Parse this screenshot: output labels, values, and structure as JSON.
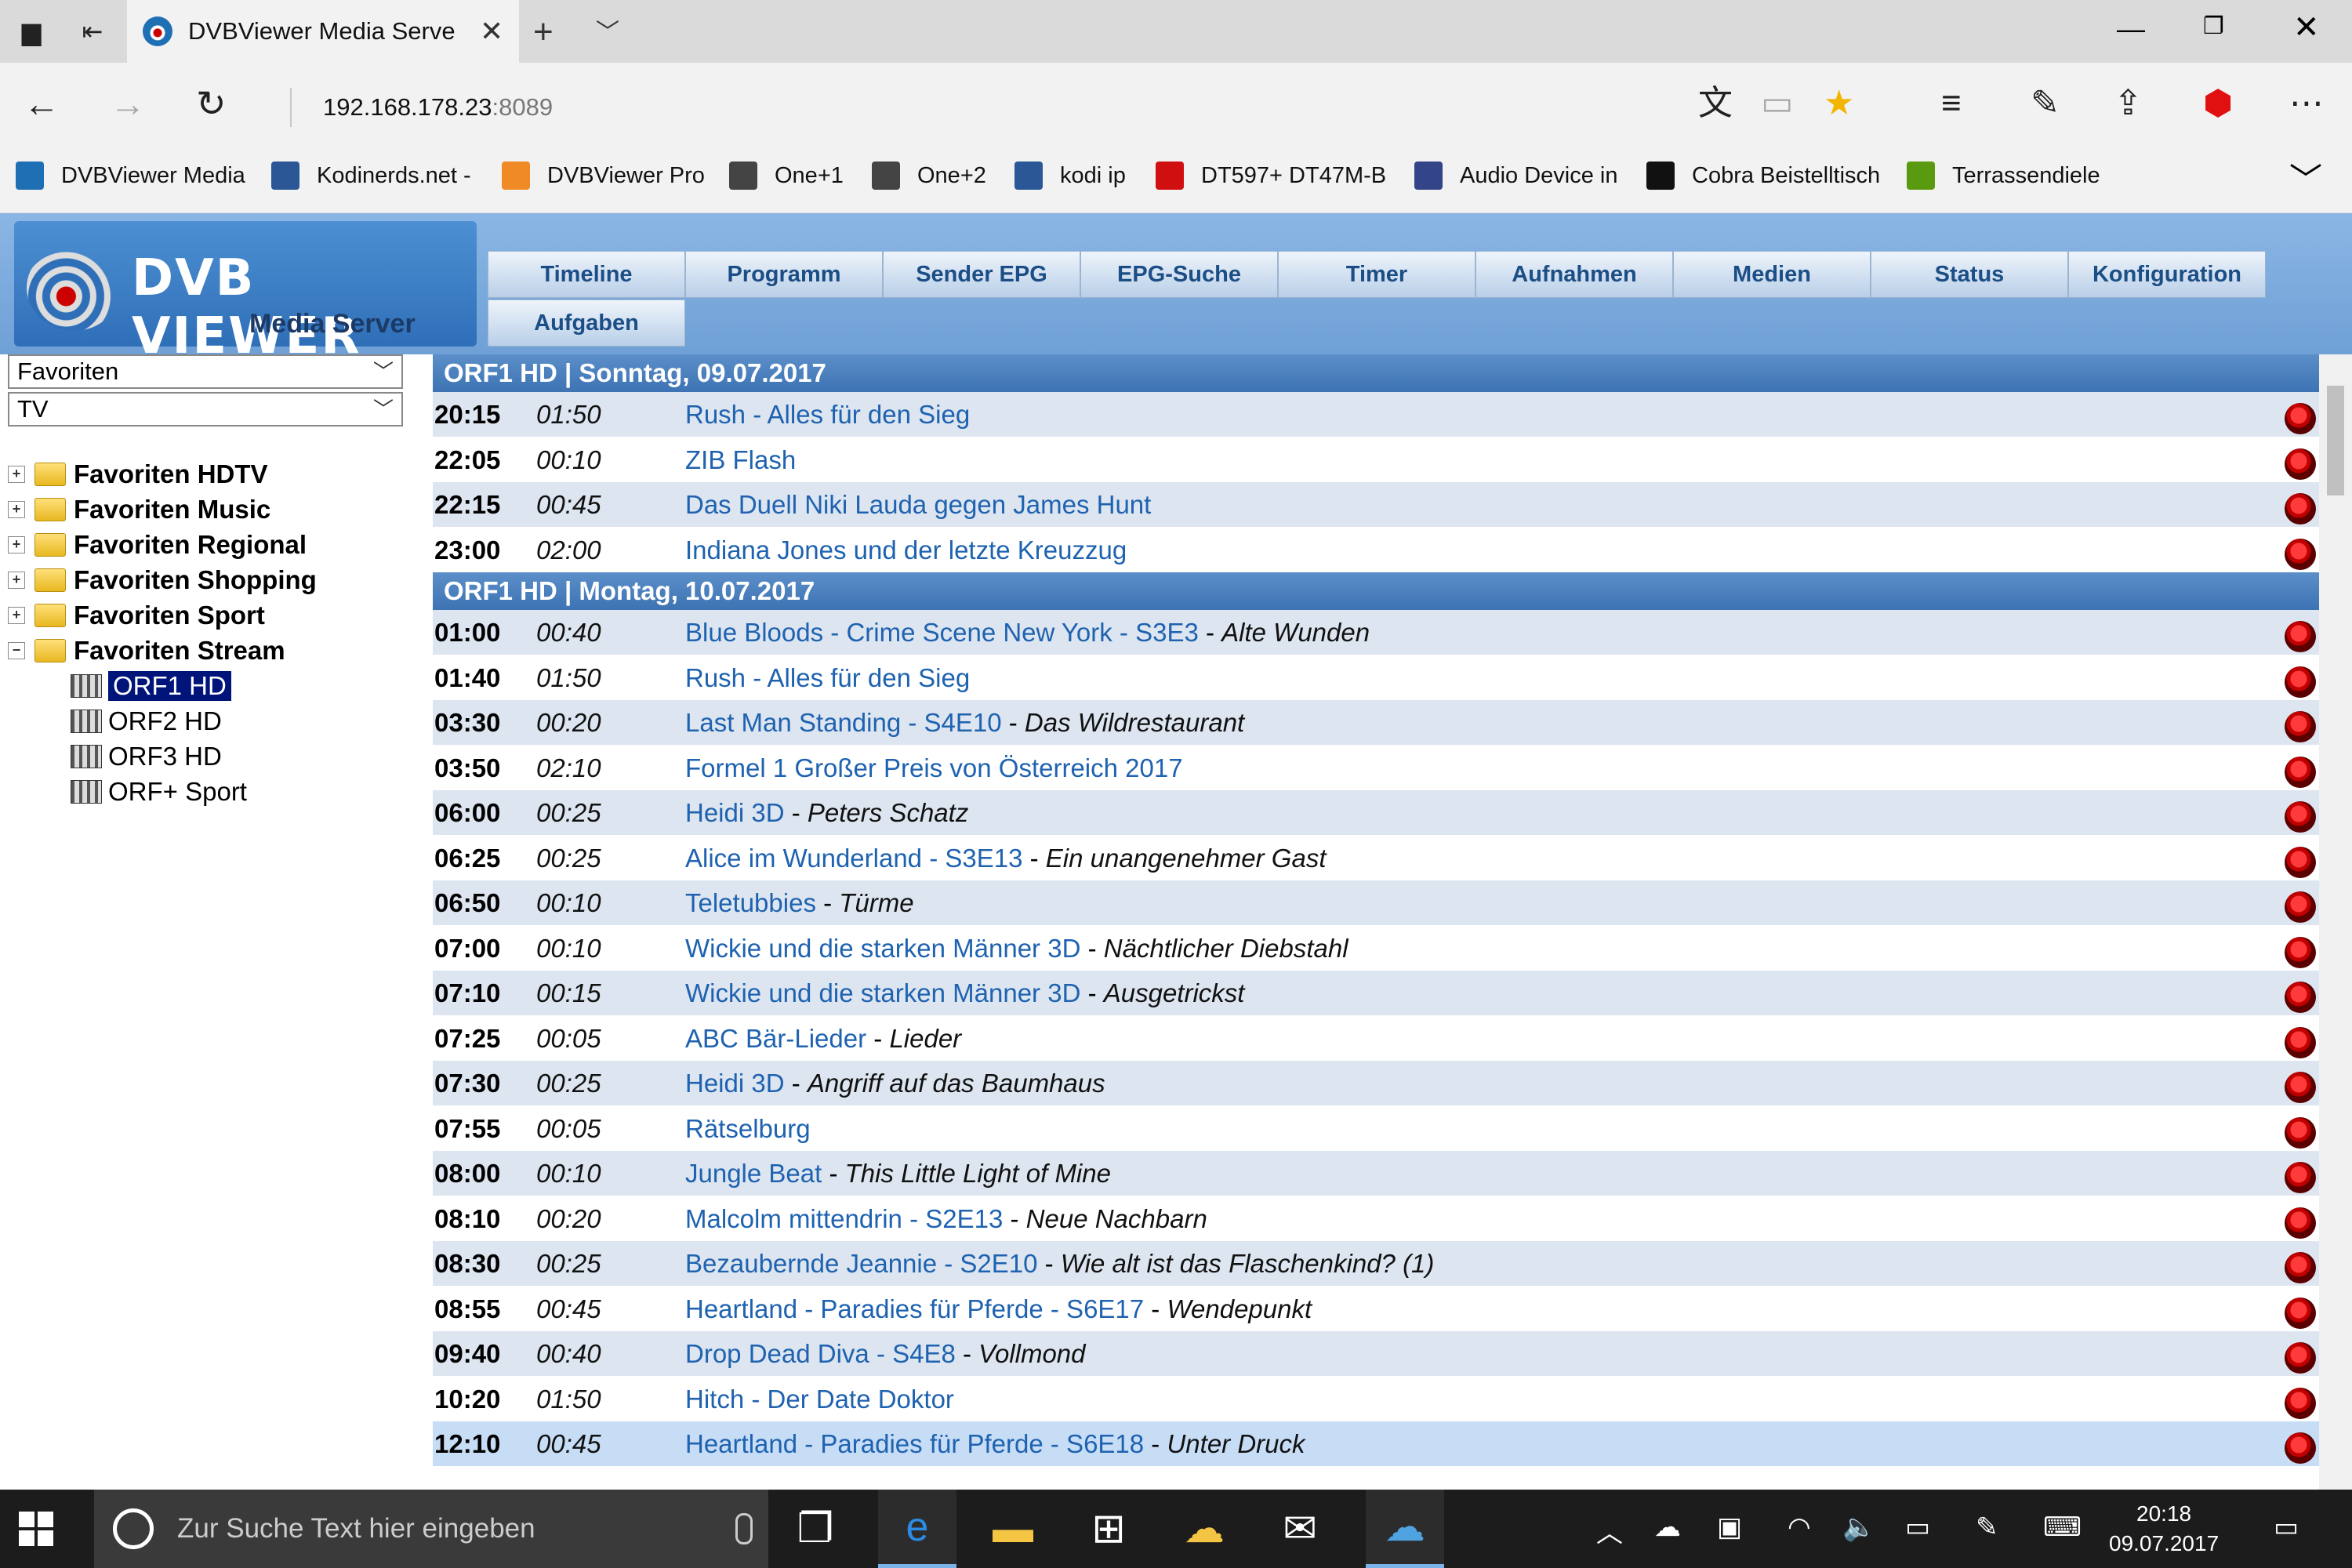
{
  "browser": {
    "tab_title": "DVBViewer Media Serve",
    "address_host": "192.168.178.23",
    "address_port": ":8089"
  },
  "favorites_bar": [
    {
      "label": "DVBViewer Media",
      "color": "#1f6fb5"
    },
    {
      "label": "Kodinerds.net -",
      "color": "#2b5797"
    },
    {
      "label": "DVBViewer Pro",
      "color": "#f08a24"
    },
    {
      "label": "One+1",
      "color": "#444444"
    },
    {
      "label": "One+2",
      "color": "#444444"
    },
    {
      "label": "kodi ip",
      "color": "#2b5797"
    },
    {
      "label": "DT597+ DT47M-B",
      "color": "#d01010"
    },
    {
      "label": "Audio Device in",
      "color": "#334488"
    },
    {
      "label": "Cobra Beistelltisch",
      "color": "#111111"
    },
    {
      "label": "Terrassendiele",
      "color": "#5a9a10"
    }
  ],
  "app": {
    "logo_name": "DVB VIEWER",
    "logo_sub": "Media Server",
    "menu": [
      "Timeline",
      "Programm",
      "Sender EPG",
      "EPG-Suche",
      "Timer",
      "Aufnahmen",
      "Medien",
      "Status",
      "Konfiguration",
      "Aufgaben"
    ]
  },
  "sidebar": {
    "select1": "Favoriten",
    "select2": "TV",
    "groups": [
      {
        "label": "Favoriten HDTV",
        "expanded": false
      },
      {
        "label": "Favoriten Music",
        "expanded": false
      },
      {
        "label": "Favoriten Regional",
        "expanded": false
      },
      {
        "label": "Favoriten Shopping",
        "expanded": false
      },
      {
        "label": "Favoriten Sport",
        "expanded": false
      },
      {
        "label": "Favoriten Stream",
        "expanded": true
      }
    ],
    "channels": [
      "ORF1 HD",
      "ORF2 HD",
      "ORF3 HD",
      "ORF+ Sport"
    ],
    "selected_channel": "ORF1 HD"
  },
  "epg": [
    {
      "header": "ORF1 HD | Sonntag, 09.07.2017",
      "rows": [
        {
          "start": "20:15",
          "duration": "01:50",
          "title": "Rush - Alles für den Sieg",
          "episode": ""
        },
        {
          "start": "22:05",
          "duration": "00:10",
          "title": "ZIB Flash",
          "episode": ""
        },
        {
          "start": "22:15",
          "duration": "00:45",
          "title": "Das Duell Niki Lauda gegen James Hunt",
          "episode": ""
        },
        {
          "start": "23:00",
          "duration": "02:00",
          "title": "Indiana Jones und der letzte Kreuzzug",
          "episode": ""
        }
      ]
    },
    {
      "header": "ORF1 HD | Montag, 10.07.2017",
      "rows": [
        {
          "start": "01:00",
          "duration": "00:40",
          "title": "Blue Bloods - Crime Scene New York - S3E3",
          "episode": "Alte Wunden"
        },
        {
          "start": "01:40",
          "duration": "01:50",
          "title": "Rush - Alles für den Sieg",
          "episode": ""
        },
        {
          "start": "03:30",
          "duration": "00:20",
          "title": "Last Man Standing - S4E10",
          "episode": "Das Wildrestaurant"
        },
        {
          "start": "03:50",
          "duration": "02:10",
          "title": "Formel 1 Großer Preis von Österreich 2017",
          "episode": ""
        },
        {
          "start": "06:00",
          "duration": "00:25",
          "title": "Heidi 3D",
          "episode": "Peters Schatz"
        },
        {
          "start": "06:25",
          "duration": "00:25",
          "title": "Alice im Wunderland - S3E13",
          "episode": "Ein unangenehmer Gast"
        },
        {
          "start": "06:50",
          "duration": "00:10",
          "title": "Teletubbies",
          "episode": "Türme"
        },
        {
          "start": "07:00",
          "duration": "00:10",
          "title": "Wickie und die starken Männer 3D",
          "episode": "Nächtlicher Diebstahl"
        },
        {
          "start": "07:10",
          "duration": "00:15",
          "title": "Wickie und die starken Männer 3D",
          "episode": "Ausgetrickst"
        },
        {
          "start": "07:25",
          "duration": "00:05",
          "title": "ABC Bär-Lieder",
          "episode": "Lieder"
        },
        {
          "start": "07:30",
          "duration": "00:25",
          "title": "Heidi 3D",
          "episode": "Angriff auf das Baumhaus"
        },
        {
          "start": "07:55",
          "duration": "00:05",
          "title": "Rätselburg",
          "episode": ""
        },
        {
          "start": "08:00",
          "duration": "00:10",
          "title": "Jungle Beat",
          "episode": "This Little Light of Mine"
        },
        {
          "start": "08:10",
          "duration": "00:20",
          "title": "Malcolm mittendrin - S2E13",
          "episode": "Neue Nachbarn"
        },
        {
          "start": "08:30",
          "duration": "00:25",
          "title": "Bezaubernde Jeannie - S2E10",
          "episode": "Wie alt ist das Flaschenkind? (1)"
        },
        {
          "start": "08:55",
          "duration": "00:45",
          "title": "Heartland - Paradies für Pferde - S6E17",
          "episode": "Wendepunkt"
        },
        {
          "start": "09:40",
          "duration": "00:40",
          "title": "Drop Dead Diva - S4E8",
          "episode": "Vollmond"
        },
        {
          "start": "10:20",
          "duration": "01:50",
          "title": "Hitch - Der Date Doktor",
          "episode": ""
        },
        {
          "start": "12:10",
          "duration": "00:45",
          "title": "Heartland - Paradies für Pferde - S6E18",
          "episode": "Unter Druck",
          "highlight": true
        }
      ]
    }
  ],
  "taskbar": {
    "search_placeholder": "Zur Suche Text hier eingeben",
    "time": "20:18",
    "date": "09.07.2017"
  }
}
